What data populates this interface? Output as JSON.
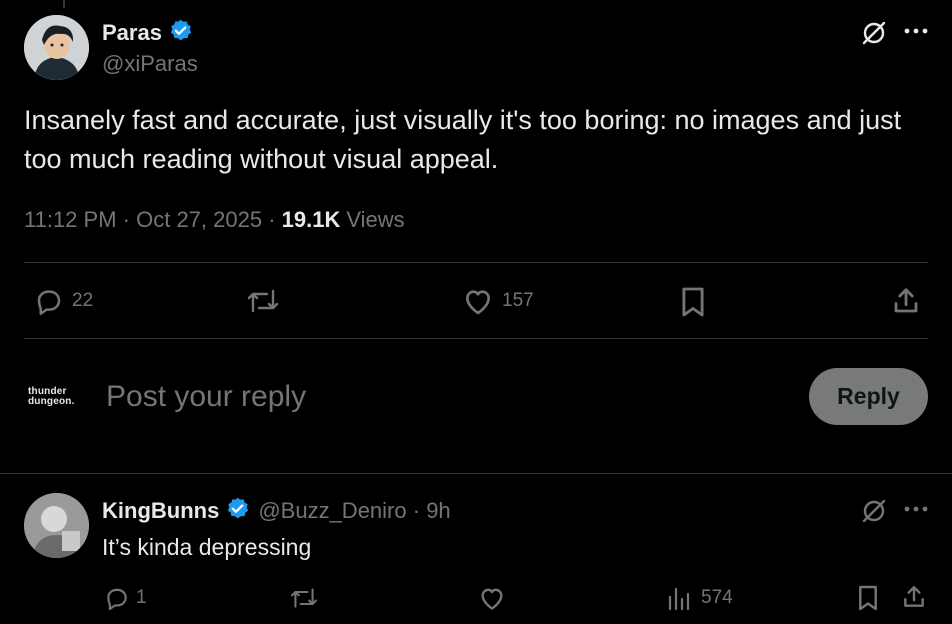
{
  "colors": {
    "background": "#000000",
    "text": "#e7e9ea",
    "muted": "#71767b",
    "verified": "#1d9bf0",
    "divider": "#2f3336",
    "reply_button_bg": "#787a7a"
  },
  "tweet": {
    "author_name": "Paras",
    "author_handle": "@xiParas",
    "text": "Insanely fast and accurate, just visually it's too boring: no images and just too much reading without visual appeal.",
    "time": "11:12 PM",
    "date": "Oct 27, 2025",
    "views_count": "19.1K",
    "views_label": "Views",
    "replies": "22",
    "likes": "157",
    "icons": {
      "grok": "grok-icon",
      "more": "more-icon",
      "reply": "reply-icon",
      "retweet": "retweet-icon",
      "like": "like-icon",
      "bookmark": "bookmark-icon",
      "share": "share-icon"
    }
  },
  "reply_composer": {
    "avatar_text_line1": "thunder",
    "avatar_text_line2": "dungeon.",
    "placeholder": "Post your reply",
    "button_label": "Reply"
  },
  "reply_tweet": {
    "author_name": "KingBunns",
    "author_handle": "@Buzz_Deniro",
    "time_ago": "9h",
    "text": "It’s kinda depressing",
    "replies": "1",
    "views": "574"
  }
}
